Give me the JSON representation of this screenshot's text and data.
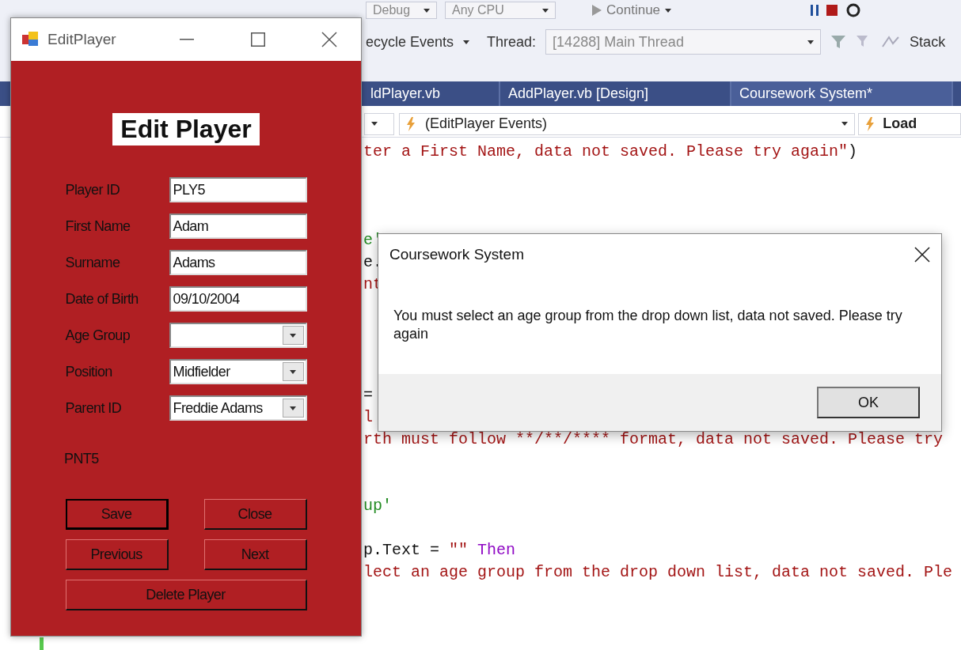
{
  "ide": {
    "toolbar": {
      "configuration": "Debug",
      "platform": "Any CPU",
      "continue_button": "Continue",
      "lifecycle_events": "ecycle Events",
      "thread_label": "Thread:",
      "thread_value": "[14288] Main Thread",
      "stack_label": "Stack"
    },
    "tabs": [
      {
        "label": "ldPlayer.vb",
        "selected": false
      },
      {
        "label": "AddPlayer.vb [Design]",
        "selected": false
      },
      {
        "label": "Coursework System*",
        "selected": true
      }
    ],
    "navigation": {
      "events": "(EditPlayer Events)",
      "member": "Load"
    },
    "code_lines": [
      {
        "kind": "code",
        "segments": [
          {
            "kind": "string",
            "text": "ter a First Name, data not saved. Please try again\""
          },
          {
            "kind": "plain",
            "text": ")"
          }
        ]
      },
      {
        "kind": "blank"
      },
      {
        "kind": "blank"
      },
      {
        "kind": "blank"
      },
      {
        "kind": "code",
        "segments": [
          {
            "kind": "comment",
            "text": "e'"
          }
        ]
      },
      {
        "kind": "code",
        "segments": [
          {
            "kind": "plain",
            "text": "e."
          }
        ]
      },
      {
        "kind": "code",
        "segments": [
          {
            "kind": "string",
            "text": "nt"
          }
        ]
      },
      {
        "kind": "blank"
      },
      {
        "kind": "blank"
      },
      {
        "kind": "blank"
      },
      {
        "kind": "blank"
      },
      {
        "kind": "code",
        "segments": [
          {
            "kind": "plain",
            "text": "="
          }
        ]
      },
      {
        "kind": "code",
        "segments": [
          {
            "kind": "string",
            "text": "l"
          }
        ]
      },
      {
        "kind": "code",
        "segments": [
          {
            "kind": "string",
            "text": "rth must follow **/**/**** format, data not saved. Please try"
          }
        ]
      },
      {
        "kind": "blank"
      },
      {
        "kind": "blank"
      },
      {
        "kind": "code",
        "segments": [
          {
            "kind": "comment",
            "text": "up'"
          }
        ]
      },
      {
        "kind": "blank"
      },
      {
        "kind": "code",
        "segments": [
          {
            "kind": "plain",
            "text": "p.Text = "
          },
          {
            "kind": "string",
            "text": "\"\""
          },
          {
            "kind": "keyword",
            "text": "Then"
          }
        ]
      },
      {
        "kind": "code",
        "segments": [
          {
            "kind": "string",
            "text": "lect an age group from the drop down list, data not saved. Ple"
          }
        ]
      }
    ]
  },
  "edit_player_window": {
    "title": "EditPlayer",
    "heading": "Edit Player",
    "fields": [
      {
        "label": "Player ID",
        "kind": "text",
        "value": "PLY5"
      },
      {
        "label": "First Name",
        "kind": "text",
        "value": "Adam"
      },
      {
        "label": "Surname",
        "kind": "text",
        "value": "Adams"
      },
      {
        "label": "Date of Birth",
        "kind": "text",
        "value": "09/10/2004"
      },
      {
        "label": "Age Group",
        "kind": "combo"
      },
      {
        "label": "Position",
        "kind": "combo",
        "value": "Midfielder"
      },
      {
        "label": "Parent ID",
        "kind": "combo",
        "value": "Freddie Adams"
      }
    ],
    "parent_code": "PNT5",
    "buttons": [
      {
        "label": "Save",
        "focused": true
      },
      {
        "label": "Close",
        "focused": false
      },
      {
        "label": "Previous",
        "focused": false
      },
      {
        "label": "Next",
        "focused": false
      },
      {
        "label": "Delete Player",
        "focused": false
      }
    ]
  },
  "message_box": {
    "title": "Coursework System",
    "message": "You must select an age group from the drop down list, data not saved. Please try again",
    "ok_button": "OK"
  }
}
